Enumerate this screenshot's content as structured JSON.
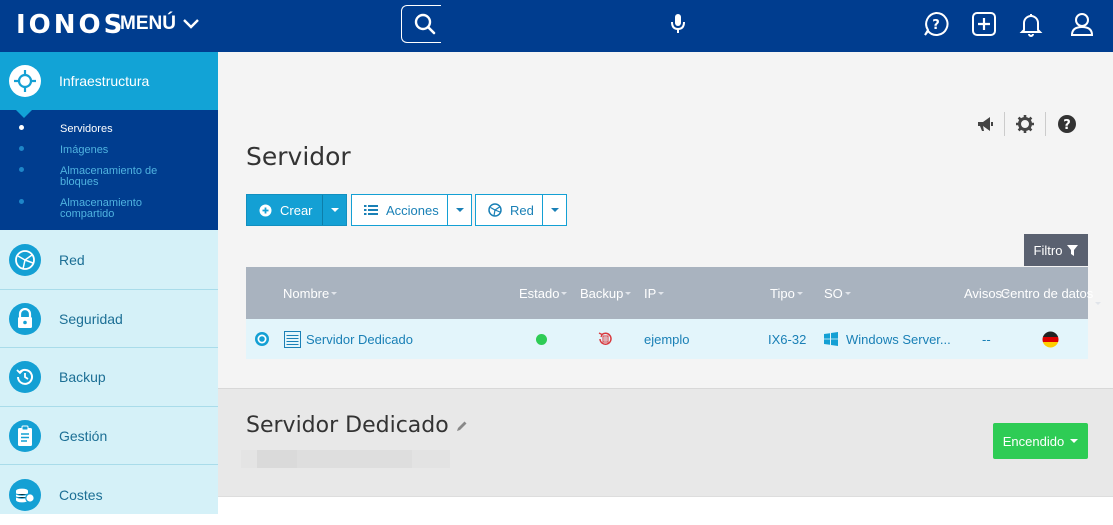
{
  "header": {
    "logo": "IONOS",
    "menu_label": "MENÚ",
    "icons": [
      "search-icon",
      "microphone-icon",
      "help-chat-icon",
      "add-icon",
      "notifications-bell-icon",
      "user-icon"
    ]
  },
  "sidebar": {
    "active_section": "Infraestructura",
    "submenu": [
      {
        "label": "Servidores",
        "active": true
      },
      {
        "label": "Imágenes",
        "active": false
      },
      {
        "label": "Almacenamiento de bloques",
        "active": false
      },
      {
        "label": "Almacenamiento compartido",
        "active": false
      }
    ],
    "sections": [
      {
        "label": "Red",
        "icon": "network-globe-icon"
      },
      {
        "label": "Seguridad",
        "icon": "lock-icon"
      },
      {
        "label": "Backup",
        "icon": "backup-clock-icon"
      },
      {
        "label": "Gestión",
        "icon": "clipboard-icon"
      },
      {
        "label": "Costes",
        "icon": "coins-icon"
      }
    ]
  },
  "main": {
    "title": "Servidor",
    "toolbar_icons": [
      "megaphone-icon",
      "settings-gear-icon",
      "help-question-icon"
    ],
    "buttons": {
      "create": "Crear",
      "actions": "Acciones",
      "network": "Red"
    },
    "filter_label": "Filtro",
    "table": {
      "columns": [
        "Nombre",
        "Estado",
        "Backup",
        "IP",
        "Tipo",
        "SO",
        "Avisos",
        "Centro de datos"
      ],
      "rows": [
        {
          "name": "Servidor Dedicado",
          "status": "online",
          "status_color": "#2ecc55",
          "backup": "backup-icon",
          "ip": "ejemplo",
          "type": "IX6-32",
          "os": "Windows Server...",
          "alerts": "--",
          "datacenter": "Germany-flag"
        }
      ]
    }
  },
  "detail": {
    "title": "Servidor Dedicado",
    "power_label": "Encendido"
  },
  "colors": {
    "brand": "#003d8f",
    "accent": "#14a0d4",
    "power_green": "#2ecc55"
  }
}
